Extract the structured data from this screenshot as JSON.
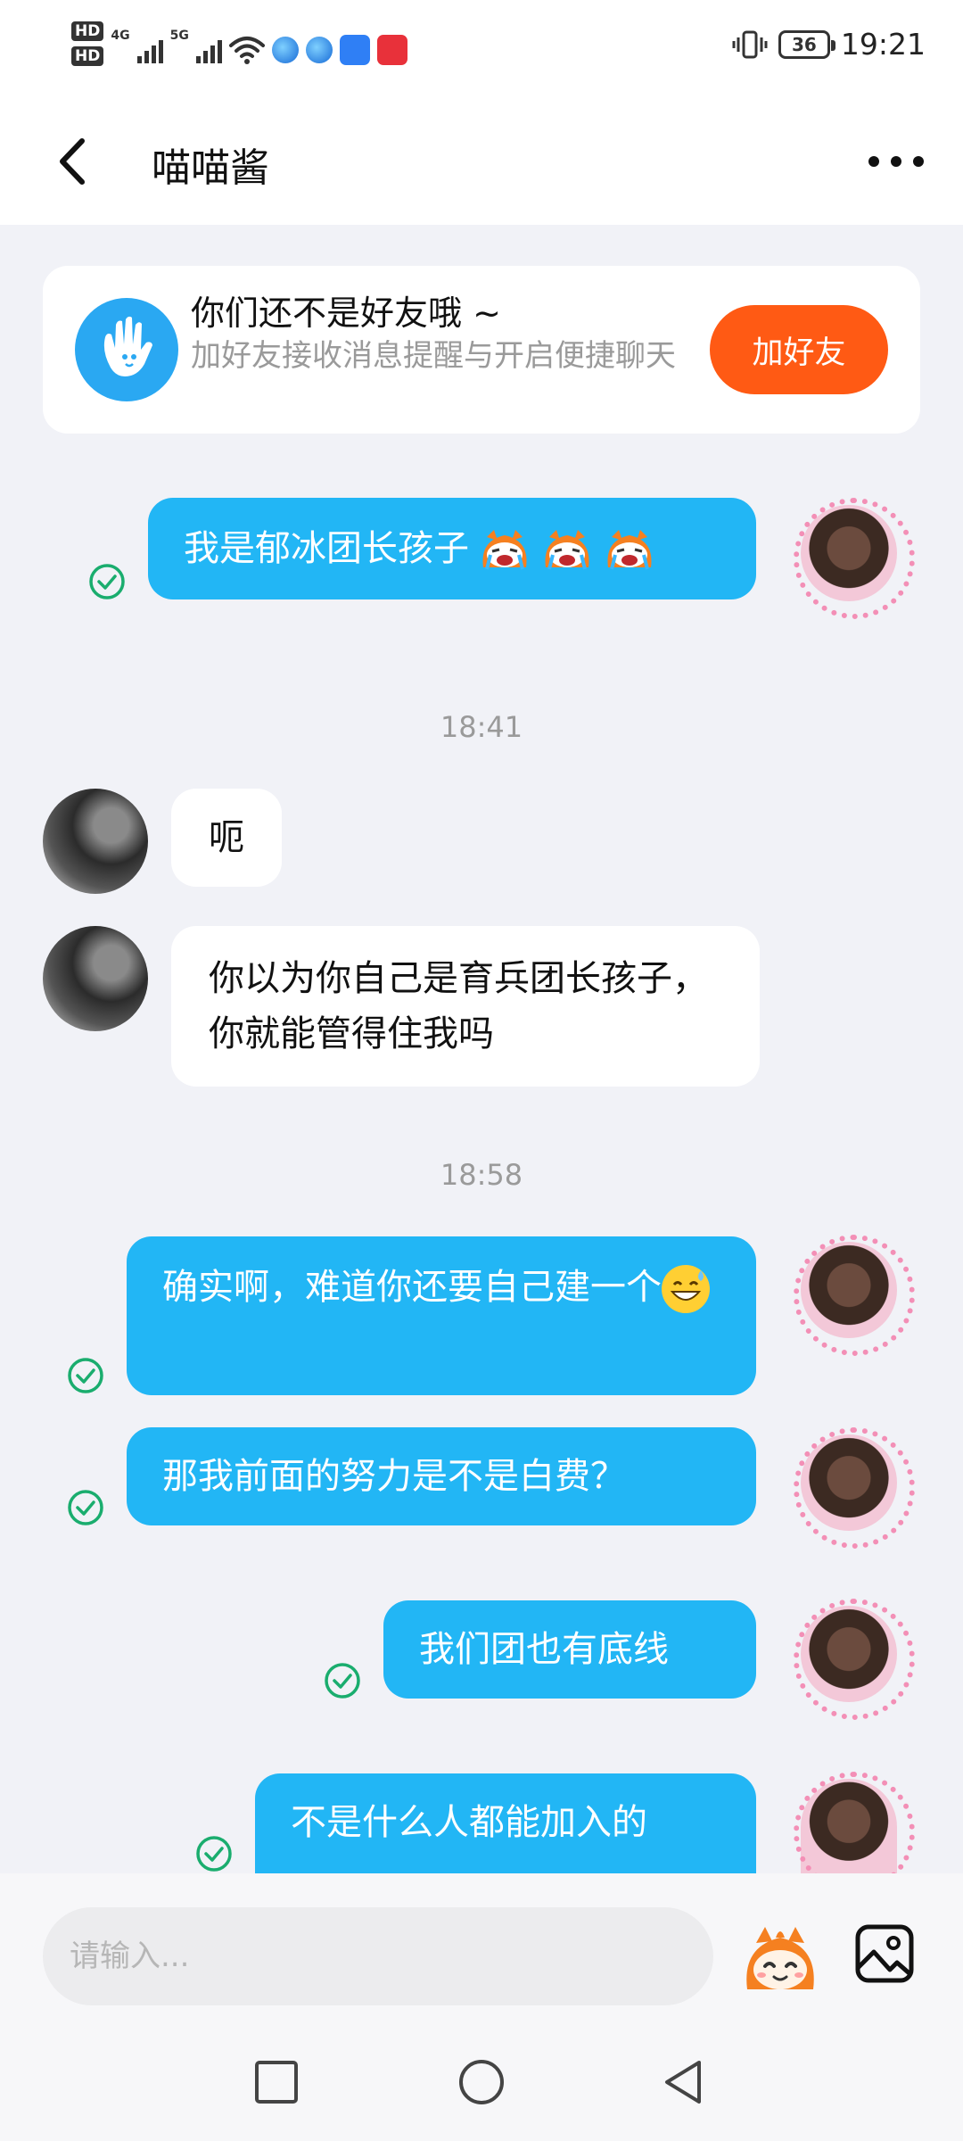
{
  "status_bar": {
    "hd1": "HD",
    "hd2": "HD",
    "net1": "4G",
    "net2": "5G",
    "battery": "36",
    "time": "19:21"
  },
  "header": {
    "title": "喵喵酱"
  },
  "friend_card": {
    "title": "你们还不是好友哦 ~",
    "subtitle": "加好友接收消息提醒与开启便捷聊天",
    "button": "加好友"
  },
  "messages": [
    {
      "side": "out",
      "text": "我是郁冰团长孩子"
    },
    {
      "type": "time",
      "text": "18:41"
    },
    {
      "side": "in",
      "text": "呃"
    },
    {
      "side": "in",
      "text": "你以为你自己是育兵团长孩子，你就能管得住我吗"
    },
    {
      "type": "time",
      "text": "18:58"
    },
    {
      "side": "out",
      "text": "确实啊，难道你还要自己建一个"
    },
    {
      "side": "out",
      "text": "那我前面的努力是不是白费？"
    },
    {
      "side": "out",
      "text": "我们团也有底线"
    },
    {
      "side": "out",
      "text": "不是什么人都能加入的"
    }
  ],
  "input": {
    "placeholder": "请输入..."
  },
  "colors": {
    "accent_blue": "#22b6f5",
    "add_friend_orange": "#ff5a14",
    "check_green": "#1aad6e"
  },
  "icons": {
    "back": "chevron-left-icon",
    "more": "more-dots-icon",
    "emoji": "emoji-face-icon",
    "image": "image-icon",
    "nav_recent": "square-icon",
    "nav_home": "circle-icon",
    "nav_back": "triangle-back-icon"
  }
}
